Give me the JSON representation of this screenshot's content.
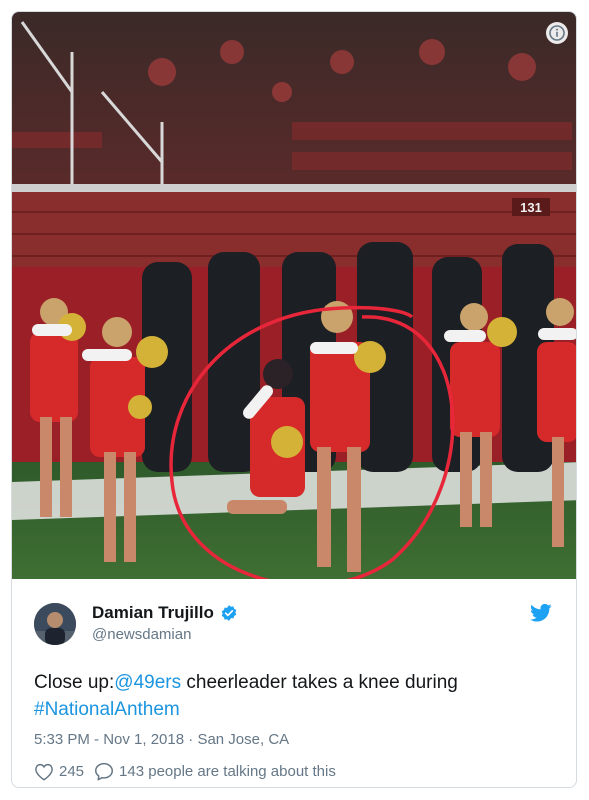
{
  "tweet": {
    "author_name": "Damian Trujillo",
    "handle": "@newsdamian",
    "text_prefix": "Close up:",
    "mention": "@49ers",
    "text_mid": " cheerleader takes a knee during",
    "hashtag": "#NationalAnthem",
    "timestamp": "5:33 PM - Nov 1, 2018",
    "location_sep": "·",
    "location": "San Jose, CA",
    "likes": "245",
    "talking": "143 people are talking about this"
  },
  "media": {
    "scoreboard_text": "131"
  },
  "colors": {
    "link": "#1b95e0",
    "secondary_text": "#657786",
    "highlight_circle": "#e8263a"
  }
}
